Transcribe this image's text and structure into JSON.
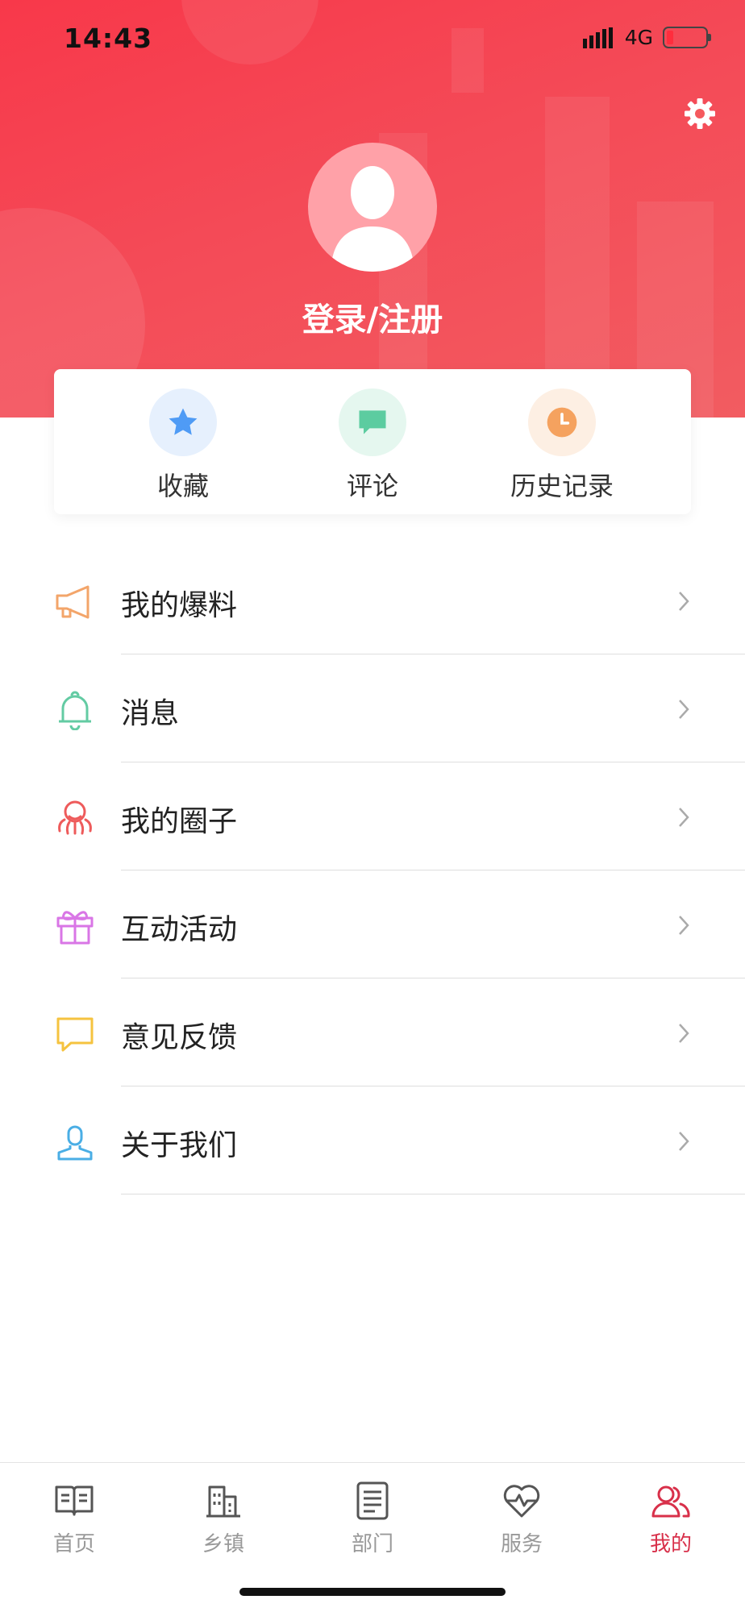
{
  "status_bar": {
    "time": "14:43",
    "network": "4G"
  },
  "header": {
    "login_label": "登录/注册"
  },
  "quick_actions": [
    {
      "label": "收藏",
      "icon": "star-icon",
      "color": "#4f9bf5",
      "bg": "#e6f0fd"
    },
    {
      "label": "评论",
      "icon": "comment-icon",
      "color": "#5ccca0",
      "bg": "#e5f7ef"
    },
    {
      "label": "历史记录",
      "icon": "clock-icon",
      "color": "#f5a25f",
      "bg": "#fdefe3"
    }
  ],
  "menu": [
    {
      "label": "我的爆料",
      "icon": "megaphone-icon",
      "color": "#f3a56a"
    },
    {
      "label": "消息",
      "icon": "bell-icon",
      "color": "#63cba3"
    },
    {
      "label": "我的圈子",
      "icon": "circle-group-icon",
      "color": "#ee5b5b"
    },
    {
      "label": "互动活动",
      "icon": "gift-icon",
      "color": "#d976e6"
    },
    {
      "label": "意见反馈",
      "icon": "feedback-bubble-icon",
      "color": "#f5c33f"
    },
    {
      "label": "关于我们",
      "icon": "user-outline-icon",
      "color": "#4aaee5"
    }
  ],
  "tabs": [
    {
      "label": "首页",
      "icon": "book-icon",
      "active": false
    },
    {
      "label": "乡镇",
      "icon": "buildings-icon",
      "active": false
    },
    {
      "label": "部门",
      "icon": "document-icon",
      "active": false
    },
    {
      "label": "服务",
      "icon": "heart-pulse-icon",
      "active": false
    },
    {
      "label": "我的",
      "icon": "users-icon",
      "active": true
    }
  ],
  "colors": {
    "brand": "#f8384a",
    "active_tab": "#d8304a"
  }
}
